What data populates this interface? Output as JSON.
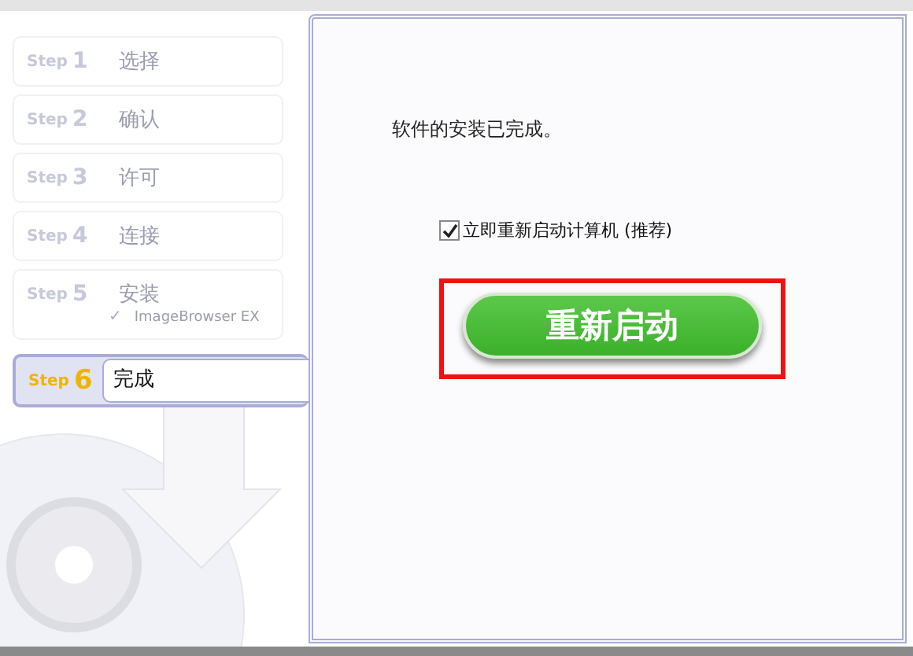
{
  "steps": [
    {
      "prefix": "Step",
      "number": "1",
      "label": "选择",
      "selected": false
    },
    {
      "prefix": "Step",
      "number": "2",
      "label": "确认",
      "selected": false
    },
    {
      "prefix": "Step",
      "number": "3",
      "label": "许可",
      "selected": false
    },
    {
      "prefix": "Step",
      "number": "4",
      "label": "连接",
      "selected": false
    },
    {
      "prefix": "Step",
      "number": "5",
      "label": "安装",
      "selected": false,
      "children": [
        {
          "check": "✓",
          "label": "ImageBrowser EX"
        }
      ]
    },
    {
      "prefix": "Step",
      "number": "6",
      "label": "完成",
      "selected": true
    }
  ],
  "message": "软件的安装已完成。",
  "restart_checkbox": {
    "label": "立即重新启动计算机 (推荐)",
    "checked": true
  },
  "restart_button": {
    "label": "重新启动",
    "highlighted": true
  }
}
